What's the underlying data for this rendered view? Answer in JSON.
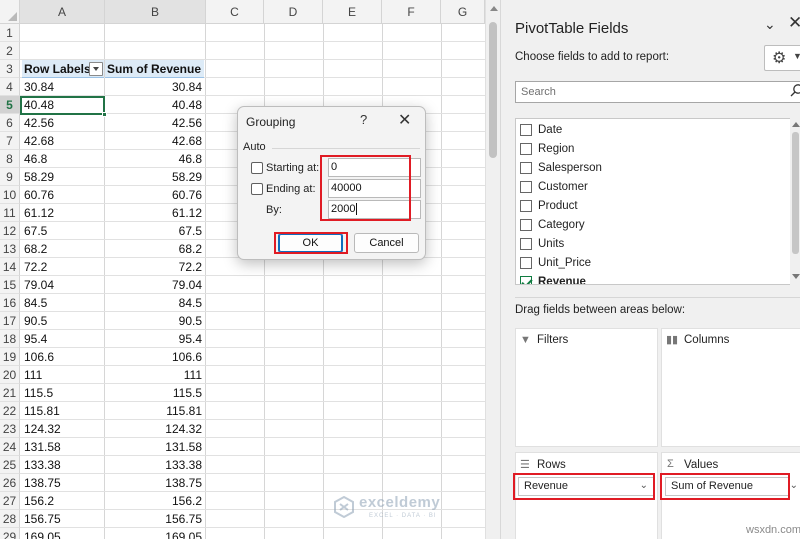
{
  "sheet": {
    "columns": [
      "A",
      "B",
      "C",
      "D",
      "E",
      "F",
      "G"
    ],
    "row_numbers": [
      "1",
      "2",
      "3",
      "4",
      "5",
      "6",
      "7",
      "8",
      "9",
      "10",
      "11",
      "12",
      "13",
      "14",
      "15",
      "16",
      "17",
      "18",
      "19",
      "20",
      "21",
      "22",
      "23",
      "24",
      "25",
      "26",
      "27",
      "28",
      "29"
    ],
    "header": {
      "row_labels": "Row Labels",
      "sum_of_revenue": "Sum of Revenue"
    },
    "rows": [
      {
        "a": "30.84",
        "b": "30.84"
      },
      {
        "a": "40.48",
        "b": "40.48"
      },
      {
        "a": "42.56",
        "b": "42.56"
      },
      {
        "a": "42.68",
        "b": "42.68"
      },
      {
        "a": "46.8",
        "b": "46.8"
      },
      {
        "a": "58.29",
        "b": "58.29"
      },
      {
        "a": "60.76",
        "b": "60.76"
      },
      {
        "a": "61.12",
        "b": "61.12"
      },
      {
        "a": "67.5",
        "b": "67.5"
      },
      {
        "a": "68.2",
        "b": "68.2"
      },
      {
        "a": "72.2",
        "b": "72.2"
      },
      {
        "a": "79.04",
        "b": "79.04"
      },
      {
        "a": "84.5",
        "b": "84.5"
      },
      {
        "a": "90.5",
        "b": "90.5"
      },
      {
        "a": "95.4",
        "b": "95.4"
      },
      {
        "a": "106.6",
        "b": "106.6"
      },
      {
        "a": "111",
        "b": "111"
      },
      {
        "a": "115.5",
        "b": "115.5"
      },
      {
        "a": "115.81",
        "b": "115.81"
      },
      {
        "a": "124.32",
        "b": "124.32"
      },
      {
        "a": "131.58",
        "b": "131.58"
      },
      {
        "a": "133.38",
        "b": "133.38"
      },
      {
        "a": "138.75",
        "b": "138.75"
      },
      {
        "a": "156.2",
        "b": "156.2"
      },
      {
        "a": "156.75",
        "b": "156.75"
      },
      {
        "a": "169.05",
        "b": "169.05"
      }
    ],
    "active_row": "5"
  },
  "dialog": {
    "title": "Grouping",
    "help": "?",
    "close": "✕",
    "section": "Auto",
    "starting_label": "Starting at:",
    "starting_value": "0",
    "ending_label": "Ending at:",
    "ending_value": "40000",
    "by_label": "By:",
    "by_value": "2000",
    "ok": "OK",
    "cancel": "Cancel"
  },
  "pane": {
    "title": "PivotTable Fields",
    "choose": "Choose fields to add to report:",
    "search_placeholder": "Search",
    "fields": [
      {
        "label": "Date",
        "checked": false
      },
      {
        "label": "Region",
        "checked": false
      },
      {
        "label": "Salesperson",
        "checked": false
      },
      {
        "label": "Customer",
        "checked": false
      },
      {
        "label": "Product",
        "checked": false
      },
      {
        "label": "Category",
        "checked": false
      },
      {
        "label": "Units",
        "checked": false
      },
      {
        "label": "Unit_Price",
        "checked": false
      },
      {
        "label": "Revenue",
        "checked": true
      }
    ],
    "drag_label": "Drag fields between areas below:",
    "filters": "Filters",
    "columns": "Columns",
    "rows": "Rows",
    "values": "Values",
    "rows_chip": "Revenue",
    "values_chip": "Sum of Revenue"
  },
  "watermark": {
    "name": "exceldemy",
    "tagline": "EXCEL · DATA · BI"
  },
  "site": "wsxdn.com",
  "colors": {
    "excel_green": "#217346",
    "highlight_red": "#e01b24",
    "header_fill": "#ddebf7",
    "ok_blue": "#0f6cbd"
  },
  "icons": [
    "gear-icon",
    "search-icon",
    "close-icon",
    "help-icon",
    "filter-icon",
    "columns-icon",
    "rows-icon",
    "sigma-icon",
    "chevron-down-icon",
    "dropdown-arrow-icon",
    "checkbox-icon",
    "exceldemy-logo-icon"
  ]
}
